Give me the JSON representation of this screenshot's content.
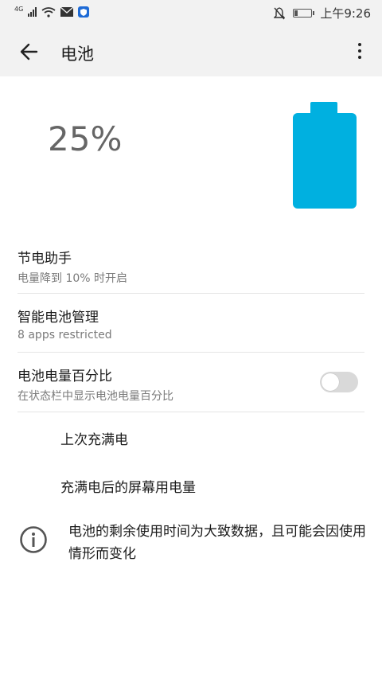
{
  "status_bar": {
    "network": "4G",
    "time": "上午9:26"
  },
  "header": {
    "title": "电池"
  },
  "battery": {
    "percent_text": "25%",
    "level_fraction": 0.25,
    "color": "#00b0e0"
  },
  "items": [
    {
      "title": "节电助手",
      "subtitle": "电量降到 10% 时开启"
    },
    {
      "title": "智能电池管理",
      "subtitle": "8 apps restricted"
    },
    {
      "title": "电池电量百分比",
      "subtitle": "在状态栏中显示电池电量百分比",
      "toggle_on": false
    }
  ],
  "links": {
    "last_full_charge": "上次充满电",
    "screen_usage": "充满电后的屏幕用电量"
  },
  "info": {
    "text": "电池的剩余使用时间为大致数据，且可能会因使用情形而变化"
  }
}
